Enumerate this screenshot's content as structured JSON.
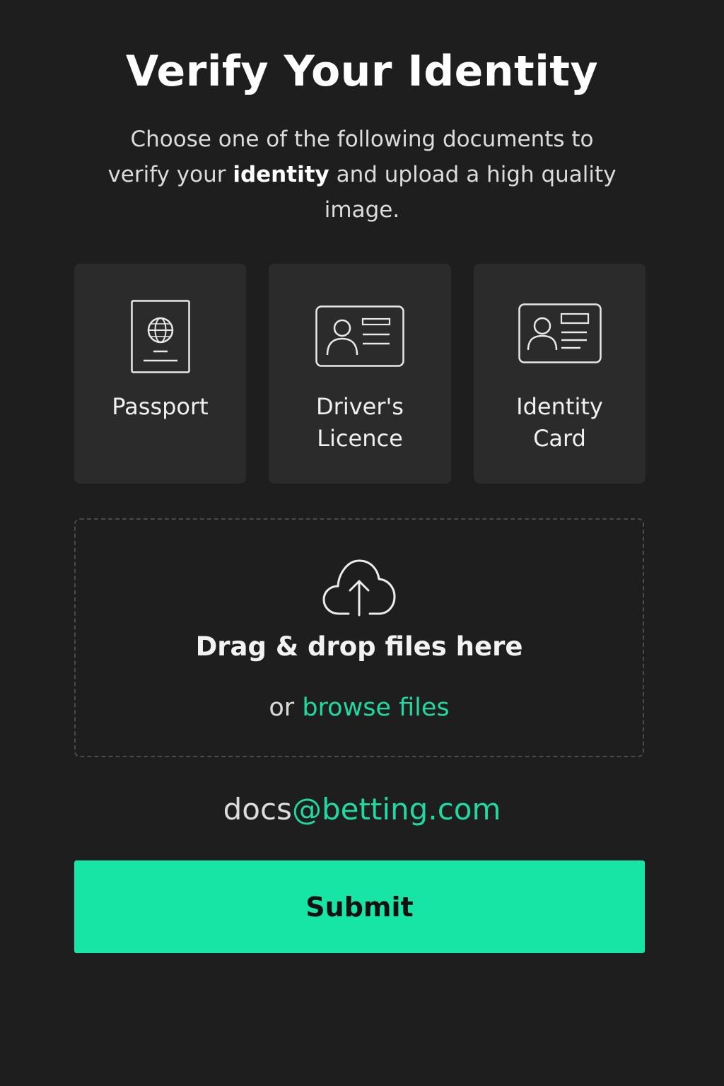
{
  "header": {
    "title": "Verify Your Identity",
    "subtitle_before": "Choose one of the following documents to verify your ",
    "subtitle_bold": "identity",
    "subtitle_after": " and upload a high quality image."
  },
  "documents": [
    {
      "label_line1": "Passport",
      "label_line2": "",
      "icon": "passport-icon"
    },
    {
      "label_line1": "Driver's",
      "label_line2": "Licence",
      "icon": "id-card-icon"
    },
    {
      "label_line1": "Identity",
      "label_line2": "Card",
      "icon": "id-card-icon"
    }
  ],
  "upload": {
    "icon": "cloud-upload-icon",
    "drag_text": "Drag & drop files here",
    "or_text": "or ",
    "browse_text": "browse files"
  },
  "contact": {
    "email_user": "docs",
    "email_domain": "@betting.com"
  },
  "actions": {
    "submit_label": "Submit"
  },
  "colors": {
    "background": "#1e1e1f",
    "card": "#2b2b2c",
    "accent": "#21d8a0",
    "button": "#17e5a5"
  }
}
